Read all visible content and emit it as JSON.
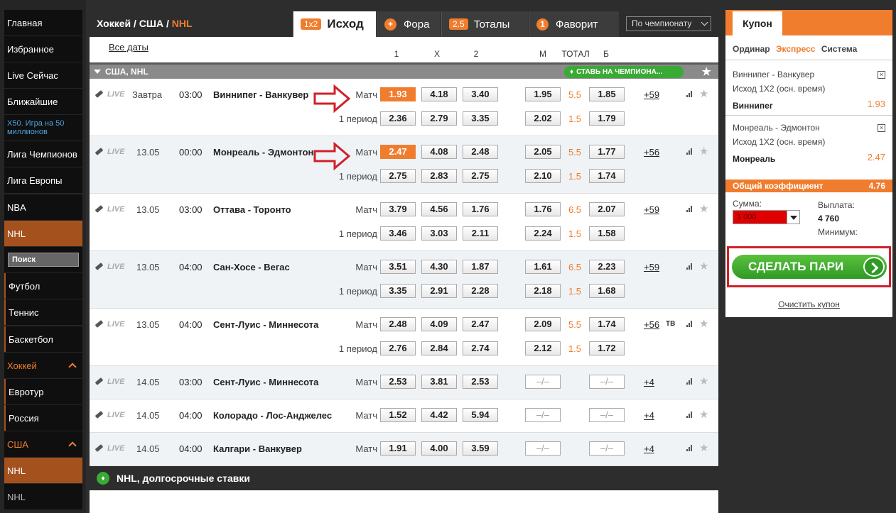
{
  "sidebar": {
    "items": [
      {
        "label": "Главная",
        "style": ""
      },
      {
        "label": "Избранное",
        "style": ""
      },
      {
        "label": "Live Сейчас",
        "style": ""
      },
      {
        "label": "Ближайшие",
        "style": ""
      },
      {
        "label": "X50. Игра на 50 миллионов",
        "style": "promo"
      },
      {
        "label": "Лига Чемпионов",
        "style": ""
      },
      {
        "label": "Лига Европы",
        "style": ""
      },
      {
        "label": "NBA",
        "style": ""
      },
      {
        "label": "NHL",
        "style": "active"
      },
      {
        "label": "Футбол",
        "style": "bar"
      },
      {
        "label": "Теннис",
        "style": "bar"
      },
      {
        "label": "Баскетбол",
        "style": "bar"
      },
      {
        "label": "Хоккей",
        "style": "hl"
      },
      {
        "label": "Евротур",
        "style": "bar"
      },
      {
        "label": "Россия",
        "style": "bar"
      },
      {
        "label": "США",
        "style": "hl"
      },
      {
        "label": "NHL",
        "style": "active"
      },
      {
        "label": "NHL",
        "style": "dim"
      }
    ],
    "search_label": "Поиск"
  },
  "header": {
    "crumb_prefix": "Хоккей / США / ",
    "crumb_current": "NHL",
    "tabs": [
      {
        "badge": "1x2",
        "label": "Исход"
      },
      {
        "badge": "+",
        "label": "Фора"
      },
      {
        "badge": "2.5",
        "label": "Тоталы"
      },
      {
        "badge": "1",
        "label": "Фаворит"
      }
    ],
    "sort_select": "По чемпионату"
  },
  "table": {
    "all_dates": "Все даты",
    "columns": [
      "1",
      "X",
      "2",
      "М",
      "ТОТАЛ",
      "Б"
    ],
    "league": "США, NHL",
    "promo": "СТАВЬ НА ЧЕМПИОНА...",
    "live_label": "LIVE",
    "events": [
      {
        "date": "Завтра",
        "time": "03:00",
        "teams": "Виннипег - Ванкувер",
        "more": "+59",
        "tv": "",
        "lines": [
          {
            "label": "Матч",
            "o1": "1.93",
            "ox": "4.18",
            "o2": "3.40",
            "m": "1.95",
            "total": "5.5",
            "b": "1.85"
          },
          {
            "label": "1 период",
            "o1": "2.36",
            "ox": "2.79",
            "o2": "3.35",
            "m": "2.02",
            "total": "1.5",
            "b": "1.79"
          }
        ]
      },
      {
        "date": "13.05",
        "time": "00:00",
        "teams": "Монреаль - Эдмонтон",
        "more": "+56",
        "tv": "",
        "lines": [
          {
            "label": "Матч",
            "o1": "2.47",
            "ox": "4.08",
            "o2": "2.48",
            "m": "2.05",
            "total": "5.5",
            "b": "1.77"
          },
          {
            "label": "1 период",
            "o1": "2.75",
            "ox": "2.83",
            "o2": "2.75",
            "m": "2.10",
            "total": "1.5",
            "b": "1.74"
          }
        ]
      },
      {
        "date": "13.05",
        "time": "03:00",
        "teams": "Оттава - Торонто",
        "more": "+59",
        "tv": "",
        "lines": [
          {
            "label": "Матч",
            "o1": "3.79",
            "ox": "4.56",
            "o2": "1.76",
            "m": "1.76",
            "total": "6.5",
            "b": "2.07"
          },
          {
            "label": "1 период",
            "o1": "3.46",
            "ox": "3.03",
            "o2": "2.11",
            "m": "2.24",
            "total": "1.5",
            "b": "1.58"
          }
        ]
      },
      {
        "date": "13.05",
        "time": "04:00",
        "teams": "Сан-Хосе - Вегас",
        "more": "+59",
        "tv": "",
        "lines": [
          {
            "label": "Матч",
            "o1": "3.51",
            "ox": "4.30",
            "o2": "1.87",
            "m": "1.61",
            "total": "6.5",
            "b": "2.23"
          },
          {
            "label": "1 период",
            "o1": "3.35",
            "ox": "2.91",
            "o2": "2.28",
            "m": "2.18",
            "total": "1.5",
            "b": "1.68"
          }
        ]
      },
      {
        "date": "13.05",
        "time": "04:00",
        "teams": "Сент-Луис - Миннесота",
        "more": "+56",
        "tv": "ТВ",
        "lines": [
          {
            "label": "Матч",
            "o1": "2.48",
            "ox": "4.09",
            "o2": "2.47",
            "m": "2.09",
            "total": "5.5",
            "b": "1.74"
          },
          {
            "label": "1 период",
            "o1": "2.76",
            "ox": "2.84",
            "o2": "2.74",
            "m": "2.12",
            "total": "1.5",
            "b": "1.72"
          }
        ]
      },
      {
        "date": "14.05",
        "time": "03:00",
        "teams": "Сент-Луис - Миннесота",
        "more": "+4",
        "tv": "",
        "lines": [
          {
            "label": "Матч",
            "o1": "2.53",
            "ox": "3.81",
            "o2": "2.53",
            "m": "–/–",
            "total": "",
            "b": "–/–"
          }
        ]
      },
      {
        "date": "14.05",
        "time": "04:00",
        "teams": "Колорадо - Лос-Анджелес",
        "more": "+4",
        "tv": "",
        "lines": [
          {
            "label": "Матч",
            "o1": "1.52",
            "ox": "4.42",
            "o2": "5.94",
            "m": "–/–",
            "total": "",
            "b": "–/–"
          }
        ]
      },
      {
        "date": "14.05",
        "time": "04:00",
        "teams": "Калгари - Ванкувер",
        "more": "+4",
        "tv": "",
        "lines": [
          {
            "label": "Матч",
            "o1": "1.91",
            "ox": "4.00",
            "o2": "3.59",
            "m": "–/–",
            "total": "",
            "b": "–/–"
          }
        ]
      }
    ],
    "longterm": "NHL, долгосрочные ставки"
  },
  "coupon": {
    "title": "Купон",
    "modes": [
      "Ординар",
      "Экспресс",
      "Система"
    ],
    "active_mode": "Экспресс",
    "bets": [
      {
        "match": "Виннипег - Ванкувер",
        "market": "Исход 1X2 (осн. время)",
        "pick": "Виннипег",
        "odd": "1.93"
      },
      {
        "match": "Монреаль - Эдмонтон",
        "market": "Исход 1X2 (осн. время)",
        "pick": "Монреаль",
        "odd": "2.47"
      }
    ],
    "total_label": "Общий коэффициент",
    "total_value": "4.76",
    "sum_label": "Сумма:",
    "sum_value": "1 000",
    "payout_label": "Выплата:",
    "payout_value": "4 760",
    "min_label": "Минимум:",
    "make_bet": "СДЕЛАТЬ ПАРИ",
    "clear": "Очистить купон"
  },
  "colors": {
    "accent": "#f07d2e",
    "selected_sidebar": "#a5511d",
    "green": "#3aaa35",
    "annotation_red": "#d0202a"
  }
}
